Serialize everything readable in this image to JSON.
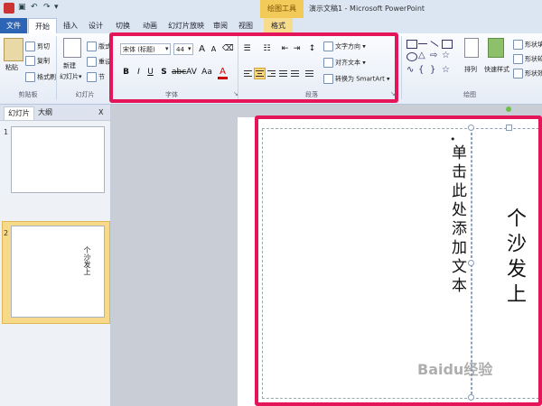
{
  "window": {
    "app_title": "演示文稿1 - Microsoft PowerPoint",
    "contextual_tools": "绘图工具"
  },
  "tabs": [
    "文件",
    "开始",
    "插入",
    "设计",
    "切换",
    "动画",
    "幻灯片放映",
    "审阅",
    "视图",
    "格式"
  ],
  "clipboard": {
    "paste": "粘贴",
    "cut": "剪切",
    "copy": "复制",
    "format_painter": "格式刷",
    "group": "剪贴板"
  },
  "slides_group": {
    "new_slide": "新建",
    "new_slide2": "幻灯片",
    "layout": "版式",
    "reset": "重设",
    "section": "节",
    "group": "幻灯片"
  },
  "font": {
    "name": "宋体 (标题)",
    "size": "44",
    "group": "字体",
    "bold": "B",
    "italic": "I",
    "underline": "U",
    "strike": "S",
    "spacing": "AV",
    "case": "Aa",
    "color_a": "A",
    "grow": "A",
    "shrink": "A"
  },
  "paragraph": {
    "text_direction": "文字方向",
    "align_text": "对齐文本",
    "smartart": "转换为 SmartArt",
    "group": "段落"
  },
  "drawing": {
    "arrange": "排列",
    "quick_styles": "快速样式",
    "shape_fill": "形状填",
    "shape_outline": "形状轮",
    "shape_effects": "形状效",
    "group": "绘图"
  },
  "panel": {
    "tab_slides": "幻灯片",
    "tab_outline": "大纲",
    "close": "X"
  },
  "thumbs": [
    {
      "num": "1",
      "text": ""
    },
    {
      "num": "2",
      "text": "个沙发上"
    }
  ],
  "slide": {
    "placeholder_text": "单击此处添加文本",
    "bullet": "•",
    "title_text": "个沙发上"
  },
  "watermark": "Baidu经验",
  "colors": {
    "highlight": "#e5155a",
    "file_tab": "#2d64b4",
    "ctx_tools": "#f2ca5a"
  }
}
